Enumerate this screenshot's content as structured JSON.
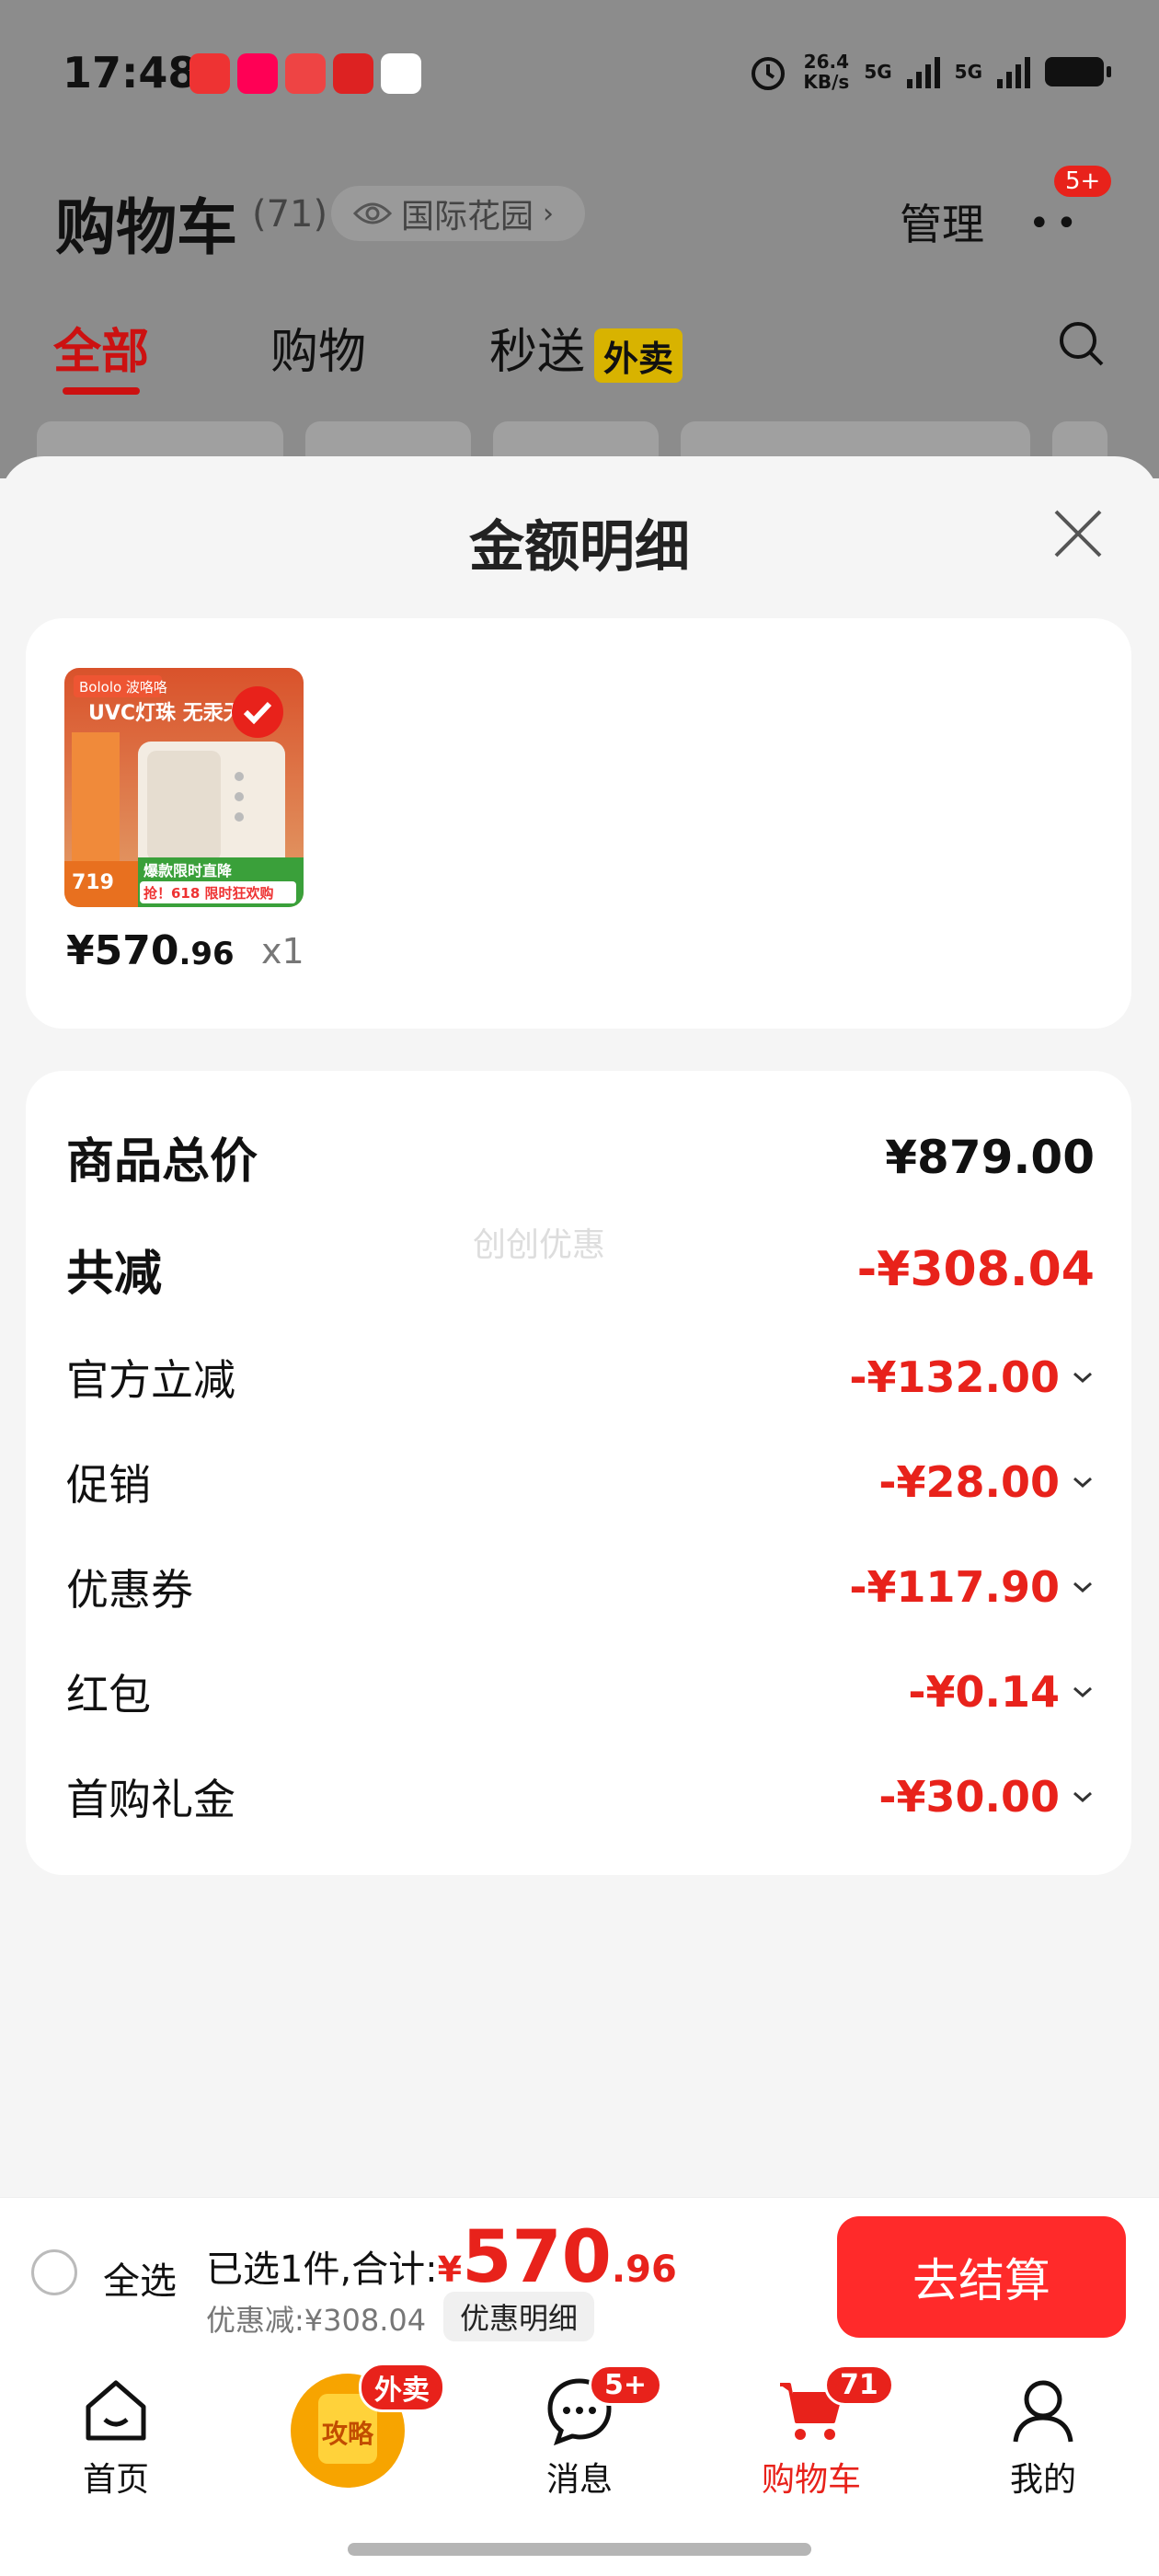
{
  "status_bar": {
    "time": "17:48",
    "net_speed_value": "26.4",
    "net_speed_unit": "KB/s",
    "signal1": "5G",
    "signal2": "5G"
  },
  "header": {
    "title": "购物车",
    "count": "(71)",
    "address": "国际花园",
    "manage": "管理",
    "more_badge": "5+"
  },
  "tabs": [
    {
      "label": "全部"
    },
    {
      "label": "购物"
    },
    {
      "label": "秒送",
      "badge": "外卖"
    }
  ],
  "sheet": {
    "title": "金额明细",
    "product": {
      "image_brand": "Bololo 波咯咯",
      "image_headline": "UVC灯珠 无汞无",
      "image_price": "719",
      "image_promo1": "爆款限时直降",
      "image_promo2": "抢！618 限时狂欢购",
      "price_int": "¥570",
      "price_dec": ".96",
      "qty": "x1"
    },
    "watermark": "创创优惠",
    "rows": [
      {
        "label": "商品总价",
        "amount": "¥879.00"
      },
      {
        "label": "共减",
        "amount": "-¥308.04"
      },
      {
        "label": "官方立减",
        "amount": "-¥132.00"
      },
      {
        "label": "促销",
        "amount": "-¥28.00"
      },
      {
        "label": "优惠券",
        "amount": "-¥117.90"
      },
      {
        "label": "红包",
        "amount": "-¥0.14"
      },
      {
        "label": "首购礼金",
        "amount": "-¥30.00"
      }
    ]
  },
  "checkout": {
    "select_all": "全选",
    "summary_prefix": "已选1件,合计:",
    "currency": "¥",
    "total_int": "570",
    "total_dec": ".96",
    "discount": "优惠减:¥308.04",
    "detail_link": "优惠明细",
    "button": "去结算"
  },
  "nav": [
    {
      "label": "首页"
    },
    {
      "label": "攻略",
      "badge": "外卖"
    },
    {
      "label": "消息",
      "badge": "5+"
    },
    {
      "label": "购物车",
      "badge": "71"
    },
    {
      "label": "我的"
    }
  ],
  "colors": {
    "accent": "#e8221b",
    "button": "#ff2a2a",
    "overlay": "#8c8c8c"
  }
}
